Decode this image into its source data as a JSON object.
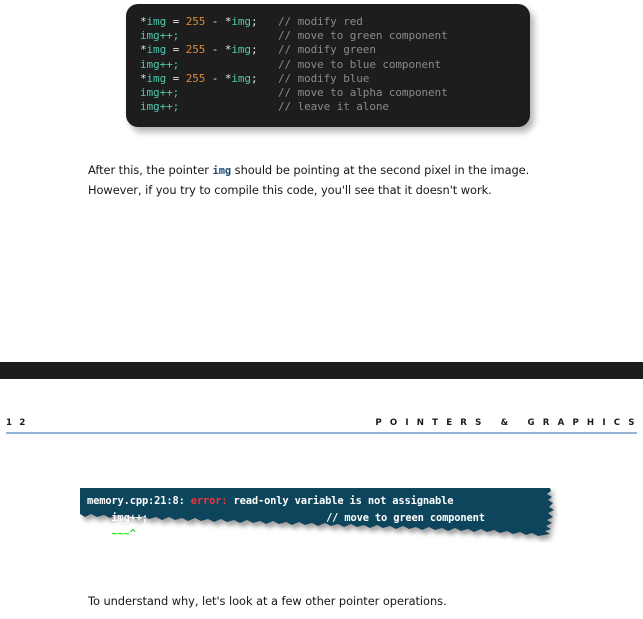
{
  "document": {
    "type": "book-page-spread",
    "page_background": "#ffffff"
  },
  "code_block": {
    "name": "pointer-increment-code-sample",
    "background": "#1d1d1d",
    "colors": {
      "identifier": "#4ec9b0",
      "number": "#d98a3a",
      "operator": "#e6e6e6",
      "comment": "#8a8a8a"
    },
    "lines": [
      {
        "deref": "*",
        "ident": "img",
        "op": " = ",
        "num": "255",
        "op2": " - ",
        "deref2": "*",
        "ident2": "img",
        "punc": ";",
        "comment": "// modify red"
      },
      {
        "plain": "img++;",
        "comment": "// move to green component"
      },
      {
        "deref": "*",
        "ident": "img",
        "op": " = ",
        "num": "255",
        "op2": " - ",
        "deref2": "*",
        "ident2": "img",
        "punc": ";",
        "comment": "// modify green"
      },
      {
        "plain": "img++;",
        "comment": "// move to blue component"
      },
      {
        "deref": "*",
        "ident": "img",
        "op": " = ",
        "num": "255",
        "op2": " - ",
        "deref2": "*",
        "ident2": "img",
        "punc": ";",
        "comment": "// modify blue"
      },
      {
        "plain": "img++;",
        "comment": "// move to alpha component"
      },
      {
        "plain": "img++;",
        "comment": "// leave it alone"
      }
    ],
    "plain_text": "*img = 255 - *img;  // modify red\nimg++;              // move to green component\n*img = 255 - *img;  // modify green\nimg++;              // move to blue component\n*img = 255 - *img;  // modify blue\nimg++;              // move to alpha component\nimg++;              // leave it alone"
  },
  "paragraph_after": {
    "part1": "After this, the pointer ",
    "code": "img",
    "part2": " should be pointing at the second pixel in the image. However, if you try to compile this code, you'll see that it doesn't work."
  },
  "running_head": {
    "folio": "1 2",
    "page_number": "12",
    "title": "P O I N T E R S   &   G R A P H I C S",
    "title_plain": "POINTERS & GRAPHICS",
    "rule_color": "#92b4d6"
  },
  "error_block": {
    "name": "compiler-error-terminal",
    "background": "#11445c",
    "error_keyword_color": "#f0353a",
    "squiggle_color": "#2ee02e",
    "line1": {
      "location": "memory.cpp:21:8: ",
      "severity": "error:",
      "message": " read-only variable is not assignable"
    },
    "line2": {
      "code": "    img++;",
      "comment": "// move to green component"
    },
    "line3": {
      "squiggle": "    ~~~^"
    },
    "plain_text": "memory.cpp:21:8: error: read-only variable is not assignable\n    img++;                          // move to green component\n    ~~~^"
  },
  "paragraph_understand": {
    "text": "To understand why, let's look at a few other pointer operations."
  }
}
